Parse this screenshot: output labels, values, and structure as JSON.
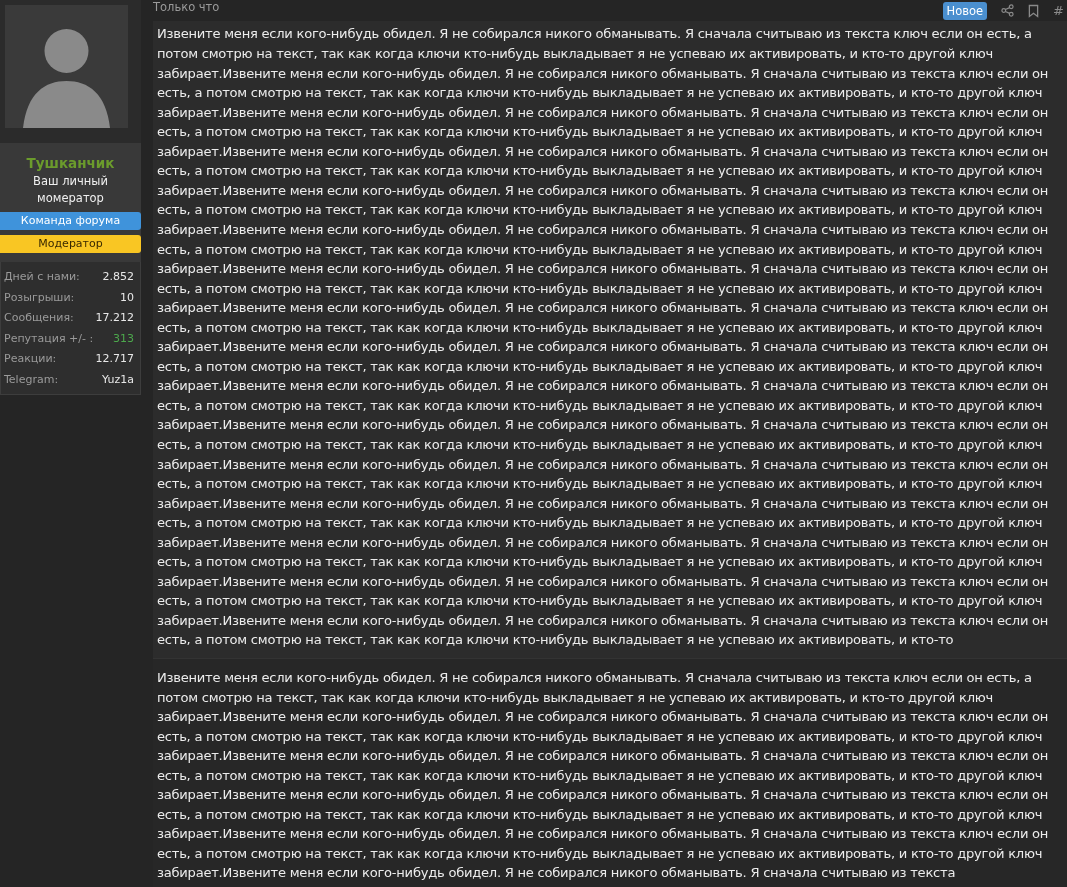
{
  "user": {
    "name": "Тушканчик",
    "title": "Ваш личный момератор",
    "banners": [
      {
        "label": "Команда форума",
        "kind": "team",
        "color": "#3f93db"
      },
      {
        "label": "Модератор",
        "kind": "moderator",
        "color": "#f9c623"
      }
    ],
    "stats": [
      {
        "label": "Дней с нами:",
        "value": "2.852",
        "color": "#e8e8e8"
      },
      {
        "label": "Розыгрыши:",
        "value": "10",
        "color": "#e8e8e8"
      },
      {
        "label": "Сообщения:",
        "value": "17.212",
        "color": "#e8e8e8"
      },
      {
        "label": "Репутация +/- :",
        "value": "313",
        "color": "#4ca84c"
      },
      {
        "label": "Реакции:",
        "value": "12.717",
        "color": "#e8e8e8"
      },
      {
        "label": "Telegram:",
        "value": "Yuz1a",
        "color": "#e8e8e8"
      }
    ]
  },
  "post": {
    "time": "Только что",
    "badge": "Новое",
    "permalink": "#",
    "blocks": [
      {
        "text": "Извените меня если кого-нибудь обидел. Я не собирался никого обманывать. Я сначала считываю из текста ключ если он есть, а потом смотрю на текст, так как когда ключи кто-нибудь выкладывает я не успеваю их активировать, и кто-то другой ключ забирает.Извените меня если кого-нибудь обидел. Я не собирался никого обманывать. Я сначала считываю из текста ключ если он есть, а потом смотрю на текст, так как когда ключи кто-нибудь выкладывает я не успеваю их активировать, и кто-то другой ключ забирает.Извените меня если кого-нибудь обидел. Я не собирался никого обманывать. Я сначала считываю из текста ключ если он есть, а потом смотрю на текст, так как когда ключи кто-нибудь выкладывает я не успеваю их активировать, и кто-то другой ключ забирает.Извените меня если кого-нибудь обидел. Я не собирался никого обманывать. Я сначала считываю из текста ключ если он есть, а потом смотрю на текст, так как когда ключи кто-нибудь выкладывает я не успеваю их активировать, и кто-то другой ключ забирает.Извените меня если кого-нибудь обидел. Я не собирался никого обманывать. Я сначала считываю из текста ключ если он есть, а потом смотрю на текст, так как когда ключи кто-нибудь выкладывает я не успеваю их активировать, и кто-то другой ключ забирает.Извените меня если кого-нибудь обидел. Я не собирался никого обманывать. Я сначала считываю из текста ключ если он есть, а потом смотрю на текст, так как когда ключи кто-нибудь выкладывает я не успеваю их активировать, и кто-то другой ключ забирает.Извените меня если кого-нибудь обидел. Я не собирался никого обманывать. Я сначала считываю из текста ключ если он есть, а потом смотрю на текст, так как когда ключи кто-нибудь выкладывает я не успеваю их активировать, и кто-то другой ключ забирает.Извените меня если кого-нибудь обидел. Я не собирался никого обманывать. Я сначала считываю из текста ключ если он есть, а потом смотрю на текст, так как когда ключи кто-нибудь выкладывает я не успеваю их активировать, и кто-то другой ключ забирает.Извените меня если кого-нибудь обидел. Я не собирался никого обманывать. Я сначала считываю из текста ключ если он есть, а потом смотрю на текст, так как когда ключи кто-нибудь выкладывает я не успеваю их активировать, и кто-то другой ключ забирает.Извените меня если кого-нибудь обидел. Я не собирался никого обманывать. Я сначала считываю из текста ключ если он есть, а потом смотрю на текст, так как когда ключи кто-нибудь выкладывает я не успеваю их активировать, и кто-то другой ключ забирает.Извените меня если кого-нибудь обидел. Я не собирался никого обманывать. Я сначала считываю из текста ключ если он есть, а потом смотрю на текст, так как когда ключи кто-нибудь выкладывает я не успеваю их активировать, и кто-то другой ключ забирает.Извените меня если кого-нибудь обидел. Я не собирался никого обманывать. Я сначала считываю из текста ключ если он есть, а потом смотрю на текст, так как когда ключи кто-нибудь выкладывает я не успеваю их активировать, и кто-то другой ключ забирает.Извените меня если кого-нибудь обидел. Я не собирался никого обманывать. Я сначала считываю из текста ключ если он есть, а потом смотрю на текст, так как когда ключи кто-нибудь выкладывает я не успеваю их активировать, и кто-то другой ключ забирает.Извените меня если кого-нибудь обидел. Я не собирался никого обманывать. Я сначала считываю из текста ключ если он есть, а потом смотрю на текст, так как когда ключи кто-нибудь выкладывает я не успеваю их активировать, и кто-то другой ключ забирает.Извените меня если кого-нибудь обидел. Я не собирался никого обманывать. Я сначала считываю из текста ключ если он есть, а потом смотрю на текст, так как когда ключи кто-нибудь выкладывает я не успеваю их активировать, и кто-то другой ключ забирает.Извените меня если кого-нибудь обидел. Я не собирался никого обманывать. Я сначала считываю из текста ключ если он есть, а потом смотрю на текст, так как когда ключи кто-нибудь выкладывает я не успеваю их активировать, и кто-то"
      },
      {
        "text": "Извените меня если кого-нибудь обидел. Я не собирался никого обманывать. Я сначала считываю из текста ключ если он есть, а потом смотрю на текст, так как когда ключи кто-нибудь выкладывает я не успеваю их активировать, и кто-то другой ключ забирает.Извените меня если кого-нибудь обидел. Я не собирался никого обманывать. Я сначала считываю из текста ключ если он есть, а потом смотрю на текст, так как когда ключи кто-нибудь выкладывает я не успеваю их активировать, и кто-то другой ключ забирает.Извените меня если кого-нибудь обидел. Я не собирался никого обманывать. Я сначала считываю из текста ключ если он есть, а потом смотрю на текст, так как когда ключи кто-нибудь выкладывает я не успеваю их активировать, и кто-то другой ключ забирает.Извените меня если кого-нибудь обидел. Я не собирался никого обманывать. Я сначала считываю из текста ключ если он есть, а потом смотрю на текст, так как когда ключи кто-нибудь выкладывает я не успеваю их активировать, и кто-то другой ключ забирает.Извените меня если кого-нибудь обидел. Я не собирался никого обманывать. Я сначала считываю из текста ключ если он есть, а потом смотрю на текст, так как когда ключи кто-нибудь выкладывает я не успеваю их активировать, и кто-то другой ключ забирает.Извените меня если кого-нибудь обидел. Я не собирался никого обманывать. Я сначала считываю из текста"
      }
    ]
  }
}
